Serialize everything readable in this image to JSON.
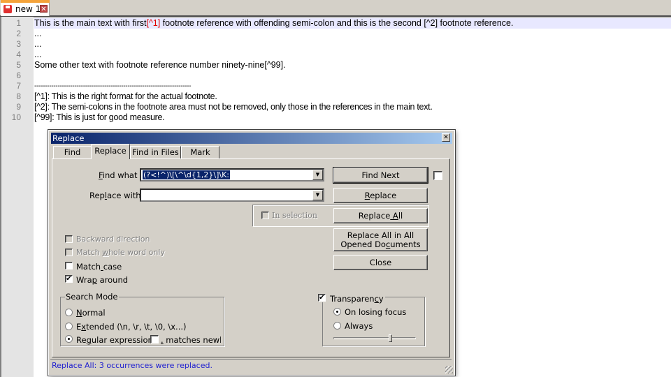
{
  "tabbar": {
    "tabs": [
      {
        "label": "new 1",
        "icon": "save-icon",
        "close_icon": "close-icon",
        "active": true
      }
    ]
  },
  "editor": {
    "lines": [
      {
        "n": "1",
        "pre": "This is the main text with first",
        "hl": "[^1]",
        "post": " footnote reference with offending semi-colon and this is the second [^2] footnote reference."
      },
      {
        "n": "2",
        "text": "..."
      },
      {
        "n": "3",
        "text": "..."
      },
      {
        "n": "4",
        "text": "..."
      },
      {
        "n": "5",
        "text": "Some other text with footnote reference number ninety-nine[^99]."
      },
      {
        "n": "6",
        "text": ""
      },
      {
        "n": "7",
        "text": "--------------------------------------------------------------------------"
      },
      {
        "n": "8",
        "text": "[^1]: This is the right format for the actual footnote."
      },
      {
        "n": "9",
        "text": "[^2]: The semi-colons in the footnote area must not be removed, only those in the references in the main text."
      },
      {
        "n": "10",
        "text": "[^99]: This is just for good measure."
      }
    ]
  },
  "dialog": {
    "title": "Replace",
    "close_icon": "close-icon",
    "tabs": [
      "Find",
      "Replace",
      "Find in Files",
      "Mark"
    ],
    "selected_tab": "Replace",
    "find_what": {
      "label_u": "F",
      "label_rest": "ind what",
      "value": "(?<!^)\\[\\^\\d{1,2}\\]\\K:"
    },
    "replace_with": {
      "label_a": "Rep",
      "label_u": "l",
      "label_b": "ace with",
      "value": ""
    },
    "in_selection": {
      "label": "In selection",
      "checked": false,
      "enabled": false
    },
    "buttons": {
      "find_next": "Find Next",
      "replace_u": "R",
      "replace_rest": "eplace",
      "replace_all_a": "Replace",
      "replace_all_u": " A",
      "replace_all_b": "ll",
      "replace_all_docs_1": "Replace All in All",
      "replace_all_docs_2a": "Opened Do",
      "replace_all_docs_2u": "c",
      "replace_all_docs_2b": "uments",
      "close": "Close"
    },
    "options": {
      "backward": {
        "label": "Backward direction",
        "checked": false,
        "enabled": false
      },
      "whole_word": {
        "label_a": "Match ",
        "label_u": "w",
        "label_b": "hole word only",
        "checked": false,
        "enabled": false
      },
      "match_case": {
        "label_a": "Match",
        "label_u": " ",
        "label_b": "case",
        "checked": false,
        "enabled": true
      },
      "wrap_around": {
        "label_a": "Wra",
        "label_u": "p",
        "label_b": " around",
        "checked": true,
        "enabled": true
      }
    },
    "search_mode": {
      "title": "Search Mode",
      "normal": {
        "label_u": "N",
        "label_b": "ormal",
        "selected": false
      },
      "extended": {
        "label_a": "E",
        "label_u": "x",
        "label_b": "tended (\\n, \\r, \\t, \\0, \\x...)",
        "selected": false
      },
      "regex": {
        "label_a": "Re",
        "label_u": "g",
        "label_b": "ular expression",
        "selected": true
      },
      "dot_newline": {
        "label_u": ".",
        "label_b": " matches newlir",
        "checked": false
      }
    },
    "transparency": {
      "label_a": "Transparen",
      "label_u": "c",
      "label_b": "y",
      "checked": true,
      "on_losing_focus": {
        "label": "On losing focus",
        "selected": true
      },
      "always": {
        "label": "Always",
        "selected": false
      },
      "slider_value_percent": 70
    },
    "status": "Replace All: 3 occurrences were replaced."
  }
}
